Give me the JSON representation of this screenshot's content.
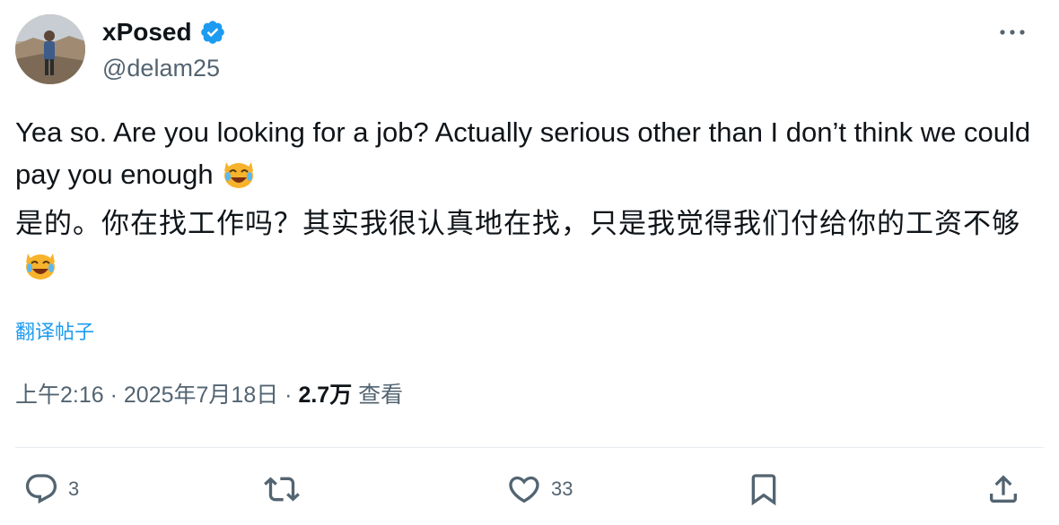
{
  "user": {
    "display_name": "xPosed",
    "handle": "@delam25",
    "verified": true,
    "verified_color": "#1d9bf0",
    "avatar_icon": "avatar-photo"
  },
  "tweet": {
    "text_en": "Yea so. Are you looking for a job? Actually serious other than I don’t think we could pay you enough",
    "text_zh": "是的。你在找工作吗？其实我很认真地在找，只是我觉得我们付给你的工资不够",
    "emoji": "😹",
    "translate_label": "翻译帖子"
  },
  "meta": {
    "time": "上午2:16",
    "separator": " · ",
    "date": "2025年7月18日",
    "views_count": "2.7万",
    "views_label": "查看"
  },
  "actions": {
    "reply_count": "3",
    "like_count": "33"
  },
  "colors": {
    "accent": "#1d9bf0",
    "text": "#0f1419",
    "muted": "#536471"
  }
}
